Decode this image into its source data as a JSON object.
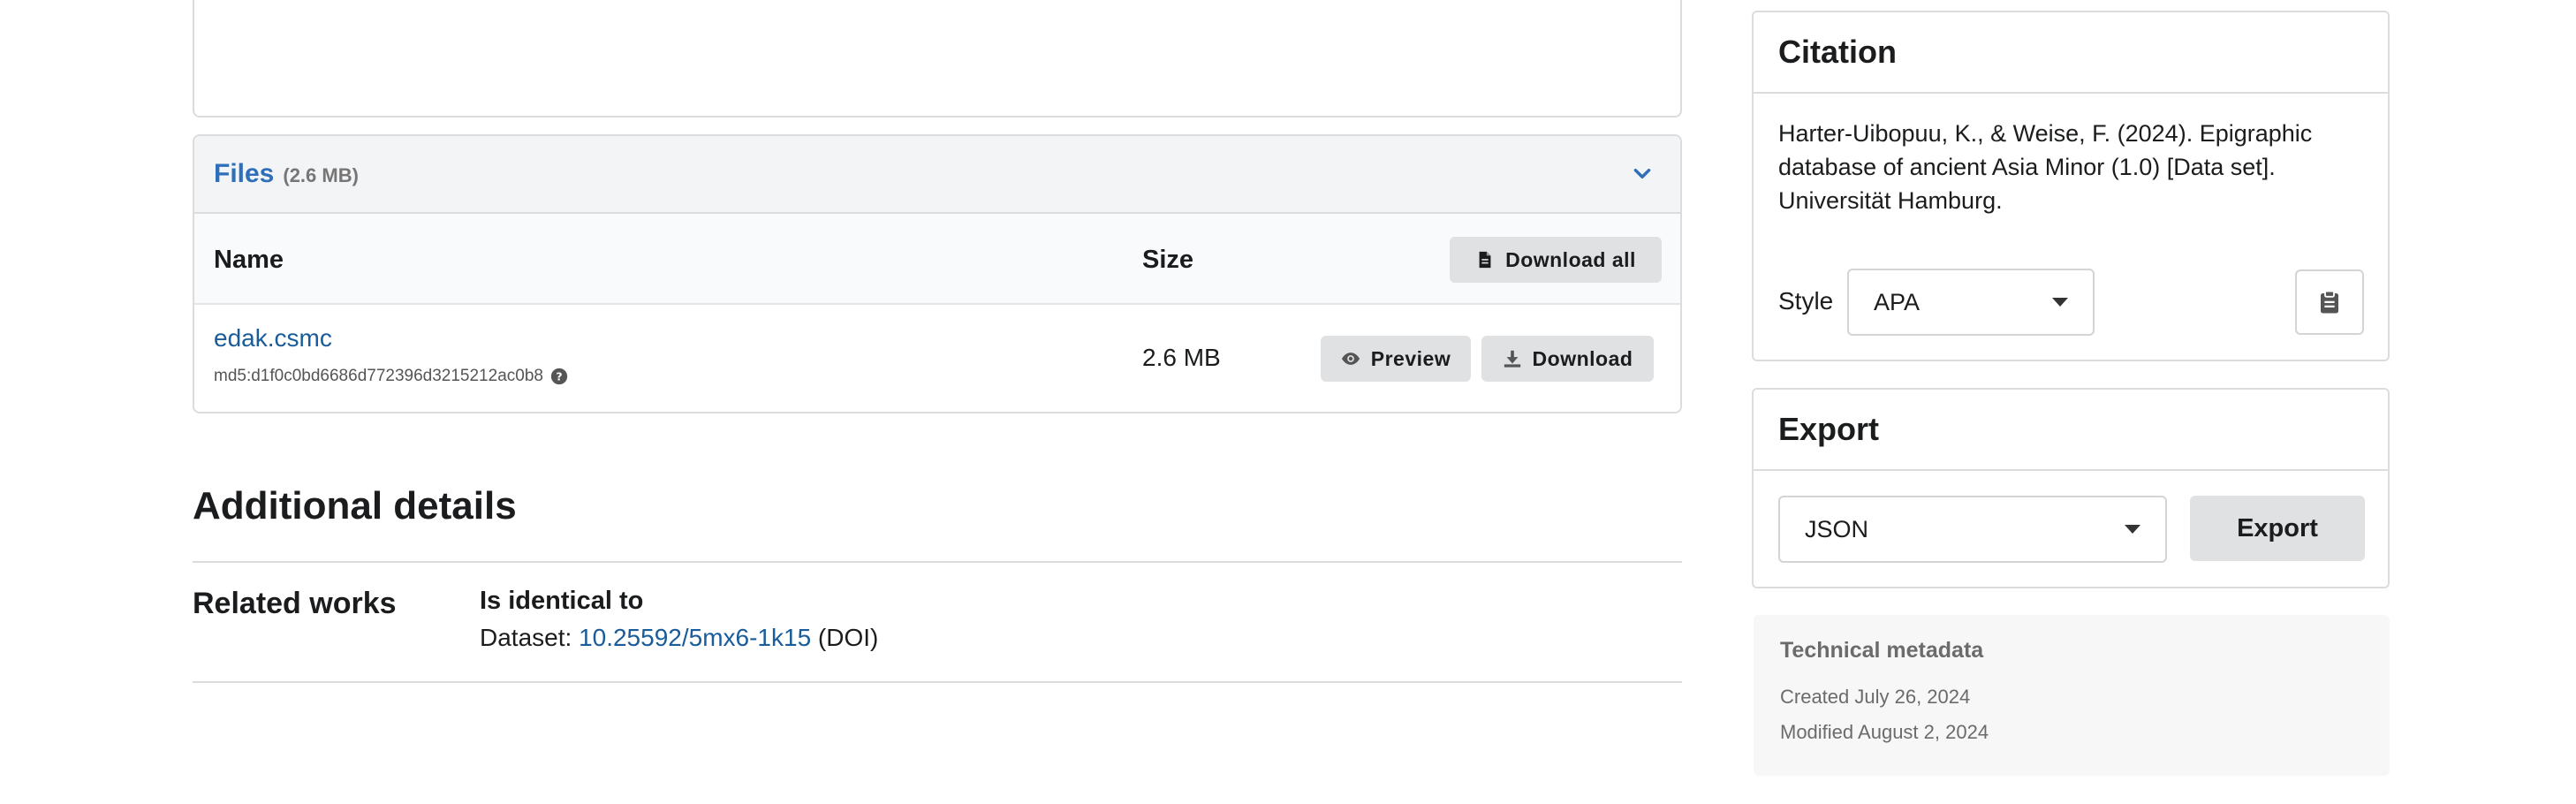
{
  "files": {
    "title": "Files",
    "total_size": "(2.6 MB)",
    "columns": {
      "name": "Name",
      "size": "Size"
    },
    "download_all_label": "Download all",
    "items": [
      {
        "name": "edak.csmc",
        "checksum": "md5:d1f0c0bd6686d772396d3215212ac0b8",
        "size": "2.6 MB",
        "preview_label": "Preview",
        "download_label": "Download"
      }
    ]
  },
  "additional_details": {
    "title": "Additional details",
    "related_works_label": "Related works",
    "relation": "Is identical to",
    "dataset_prefix": "Dataset: ",
    "dataset_link": "10.25592/5mx6-1k15",
    "dataset_suffix": " (DOI)"
  },
  "citation": {
    "title": "Citation",
    "text": "Harter-Uibopuu, K., & Weise, F. (2024). Epigraphic database of ancient Asia Minor (1.0) [Data set]. Universität Hamburg.",
    "style_label": "Style",
    "style_value": "APA"
  },
  "export": {
    "title": "Export",
    "format_value": "JSON",
    "button_label": "Export"
  },
  "technical_metadata": {
    "title": "Technical metadata",
    "created": "Created July 26, 2024",
    "modified": "Modified August 2, 2024"
  },
  "colors": {
    "link": "#1a5c99",
    "accent_title": "#2f6fba",
    "button_bg": "#e0e1e2",
    "border": "#dcdcdc"
  },
  "icons": [
    "chevron-down-icon",
    "file-icon",
    "eye-icon",
    "download-icon",
    "question-circle-icon",
    "clipboard-icon"
  ]
}
